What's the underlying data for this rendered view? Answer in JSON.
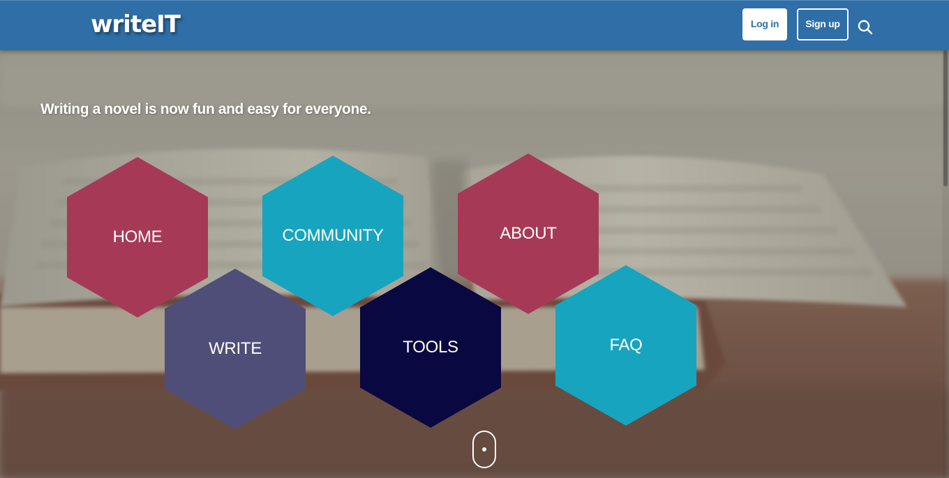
{
  "header": {
    "logo": "writeIT",
    "login_label": "Log in",
    "signup_label": "Sign up",
    "search_icon": "search-icon",
    "background_color": "#2f6ea6"
  },
  "hero": {
    "tagline": "Writing a novel is now fun and easy for everyone."
  },
  "nav_hexagons": [
    {
      "label": "HOME",
      "color": "#a63a56"
    },
    {
      "label": "COMMUNITY",
      "color": "#17a4bf"
    },
    {
      "label": "ABOUT",
      "color": "#a63a56"
    },
    {
      "label": "WRITE",
      "color": "#4f4e78"
    },
    {
      "label": "TOOLS",
      "color": "#0a0840"
    },
    {
      "label": "FAQ",
      "color": "#17a4bf"
    }
  ],
  "scroll_indicator_icon": "mouse-scroll-icon"
}
